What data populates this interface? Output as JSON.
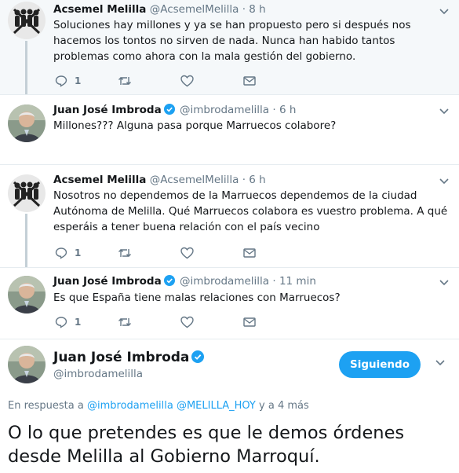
{
  "tweets": [
    {
      "name": "Acsemel Melilla",
      "handle": "@AcsemelMelilla",
      "sep": "·",
      "time": "8 h",
      "text": "Soluciones hay millones y ya se han propuesto pero si después nos hacemos los tontos no sirven de nada. Nunca han habido tantos problemas como ahora con la mala gestión del gobierno.",
      "replies": "1",
      "avatar": "group-icon"
    },
    {
      "name": "Juan José Imbroda",
      "handle": "@imbrodamelilla",
      "sep": "·",
      "time": "6 h",
      "text": "Millones??? Alguna pasa porque Marruecos colabore?",
      "avatar": "person-icon"
    },
    {
      "name": "Acsemel Melilla",
      "handle": "@AcsemelMelilla",
      "sep": "·",
      "time": "6 h",
      "text": "Nosotros no dependemos de la Marruecos dependemos de la ciudad Autónoma de Melilla. Qué Marruecos colabora es vuestro problema. A qué esperáis a tener buena relación con el país vecino",
      "replies": "1",
      "avatar": "group-icon"
    },
    {
      "name": "Juan José Imbroda",
      "handle": "@imbrodamelilla",
      "sep": "·",
      "time": "11 min",
      "text": "Es que España tiene malas relaciones con Marruecos?",
      "replies": "1",
      "avatar": "person-icon"
    }
  ],
  "main": {
    "name": "Juan José Imbroda",
    "handle": "@imbrodamelilla",
    "follow_label": "Siguiendo",
    "reply_prefix": "En respuesta a",
    "reply_links": "@imbrodamelilla @MELILLA_HOY",
    "reply_suffix": "y a 4 más",
    "text": "O lo que pretendes es que le demos órdenes desde Melilla al Gobierno Marroquí."
  },
  "colors": {
    "accent": "#1da1f2",
    "secondary_text": "#657786",
    "highlight_bg": "#f5f8fa"
  }
}
